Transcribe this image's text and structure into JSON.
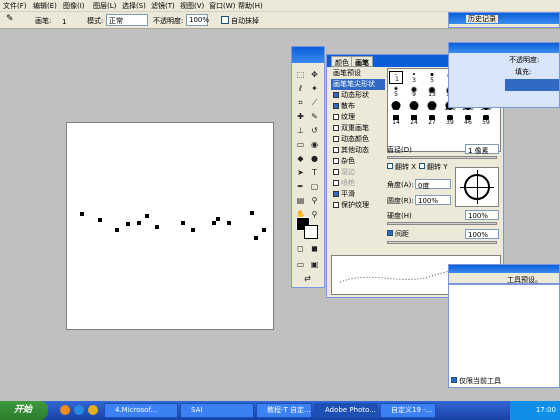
{
  "menu": [
    "文件(F)",
    "编辑(E)",
    "图像(I)",
    "图层(L)",
    "选择(S)",
    "滤镜(T)",
    "视图(V)",
    "窗口(W)",
    "帮助(H)"
  ],
  "options": {
    "brush_label": "画笔:",
    "brush_size": "1",
    "mode_label": "模式:",
    "mode_value": "正常",
    "opacity_label": "不透明度:",
    "opacity_value": "100%",
    "airbrush_label": "自动抹掉"
  },
  "brush_panel": {
    "tabs": [
      "颜色",
      "画笔"
    ],
    "list": [
      "画笔预设",
      "画笔笔尖形状",
      "动态形状",
      "散布",
      "纹理",
      "双重画笔",
      "动态颜色",
      "其他动态",
      "杂色",
      "湿边",
      "喷枪",
      "平滑",
      "保护纹理"
    ],
    "checked": [
      false,
      false,
      true,
      true,
      false,
      false,
      false,
      false,
      false,
      false,
      false,
      true,
      false
    ],
    "dimmed": [
      false,
      false,
      false,
      false,
      false,
      false,
      false,
      false,
      false,
      true,
      true,
      false,
      false
    ],
    "tips": [
      "1",
      "3",
      "5",
      "9",
      "13",
      "19",
      "5",
      "9",
      "13",
      "17",
      "21",
      "27",
      "35",
      "45",
      "65",
      "100",
      "200",
      "300",
      "14",
      "24",
      "27",
      "39",
      "46",
      "59"
    ],
    "diameter_label": "直径(D)",
    "diameter_value": "1 像素",
    "flip_x": "翻转 X",
    "flip_y": "翻转 Y",
    "angle_label": "角度(A):",
    "angle_value": "0度",
    "roundness_label": "圆度(R):",
    "roundness_value": "100%",
    "hardness_label": "硬度(H)",
    "hardness_value": "100%",
    "spacing_label": "间距",
    "spacing_value": "100%"
  },
  "right_panel": {
    "history_tab": "历史记录",
    "nav_tab": "画笔",
    "opacity": "不透明度:",
    "fill": "填充:",
    "tool_text": "工具预设。",
    "current_tool": "仅限当前工具"
  },
  "taskbar": {
    "start": "开始",
    "buttons": [
      "4.Microsof...",
      "SAI",
      "教程-T 自定...",
      "Adobe Photo...",
      "自定义19 -..."
    ],
    "time": "17:00"
  }
}
